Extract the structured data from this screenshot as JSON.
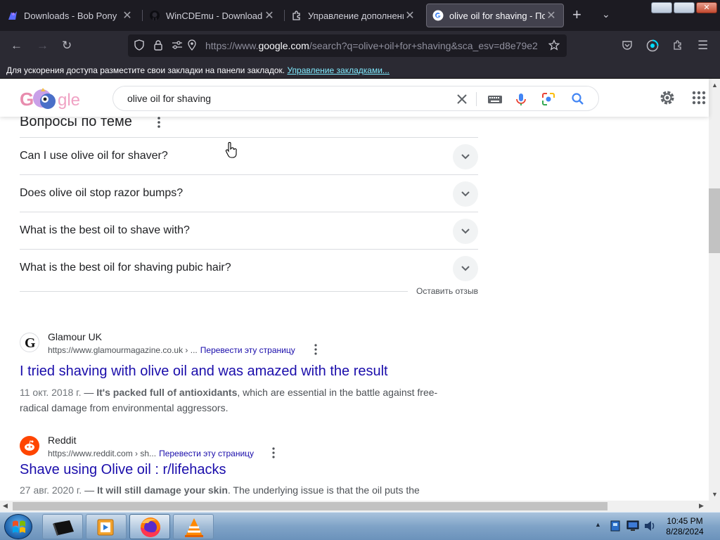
{
  "browser": {
    "tabs": [
      {
        "title": "Downloads - Bob Pony",
        "icon": "bobpony-icon",
        "active": false
      },
      {
        "title": "WinCDEmu - Download",
        "icon": "github-icon",
        "active": false
      },
      {
        "title": "Управление дополнениями",
        "icon": "puzzle-icon",
        "active": false
      },
      {
        "title": "olive oil for shaving - Поиск",
        "icon": "google-icon",
        "active": true
      }
    ],
    "url": {
      "prefix": "https://www.",
      "domain": "google.com",
      "path": "/search?q=olive+oil+for+shaving&sca_esv=d8e79e2"
    },
    "bookmarks_bar": {
      "message": "Для ускорения доступа разместите свои закладки на панели закладок. ",
      "link": "Управление закладками..."
    }
  },
  "google": {
    "query": "olive oil for shaving"
  },
  "paa": {
    "title": "Вопросы по теме",
    "questions": [
      "Can I use olive oil for shaver?",
      "Does olive oil stop razor bumps?",
      "What is the best oil to shave with?",
      "What is the best oil for shaving pubic hair?"
    ],
    "feedback": "Оставить отзыв"
  },
  "results": [
    {
      "site": "Glamour UK",
      "url": "https://www.glamourmagazine.co.uk › ...",
      "translate": "Перевести эту страницу",
      "title": "I tried shaving with olive oil and was amazed with the result",
      "date": "11 окт. 2018 г.",
      "dash": " — ",
      "bold": "It's packed full of antioxidants",
      "rest": ", which are essential in the battle against free-radical damage from environmental aggressors."
    },
    {
      "site": "Reddit",
      "url": "https://www.reddit.com › sh...",
      "translate": "Перевести эту страницу",
      "title": "Shave using Olive oil : r/lifehacks",
      "date": "27 авг. 2020 г.",
      "dash": " — ",
      "bold": "It will still damage your skin",
      "rest": ". The underlying issue is that the oil puts the"
    }
  ],
  "taskbar": {
    "clock_time": "10:45 PM",
    "clock_date": "8/28/2024",
    "apps": [
      "terminal-icon",
      "media-player-icon",
      "firefox-icon",
      "vlc-icon"
    ]
  },
  "colors": {
    "link": "#1a0dab",
    "tab_bg": "#1c1b22",
    "toolbar_bg": "#2b2a33"
  }
}
